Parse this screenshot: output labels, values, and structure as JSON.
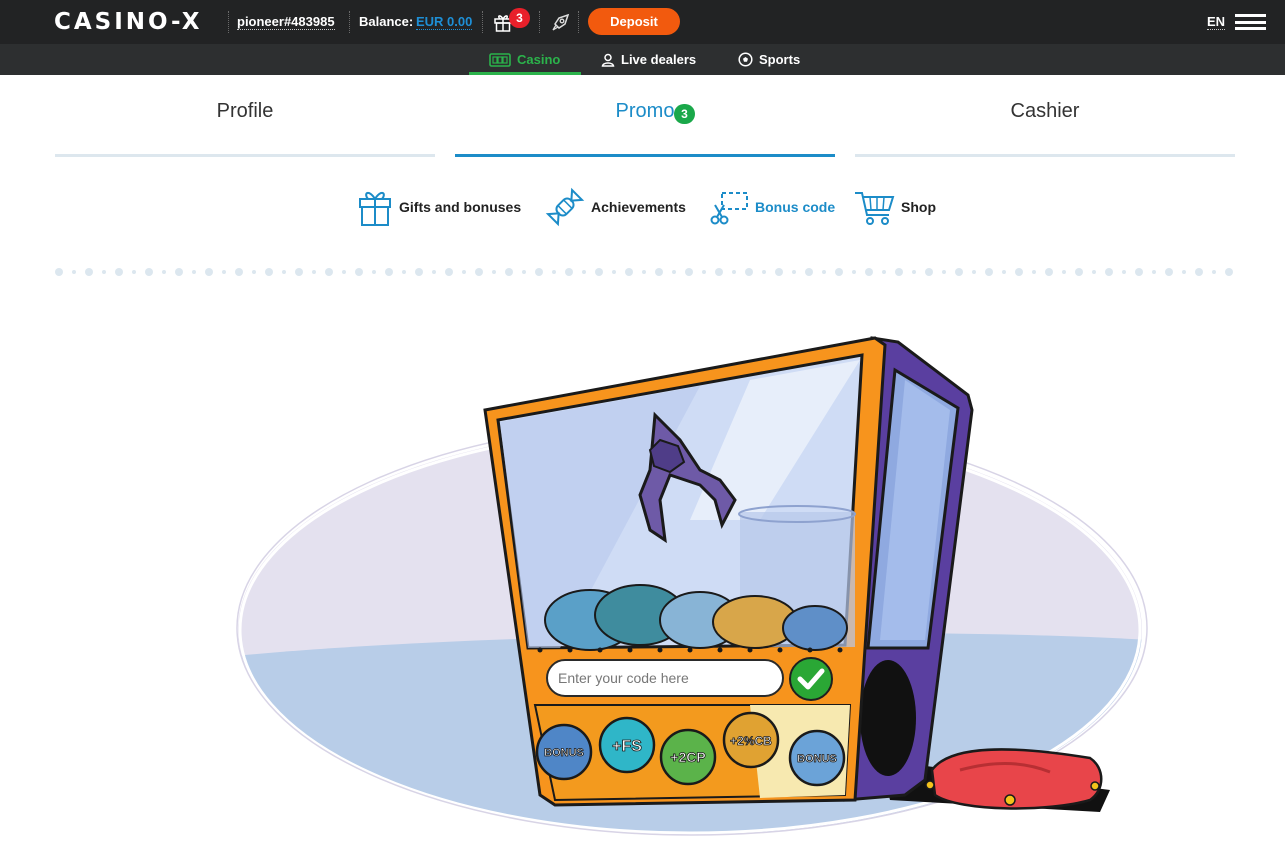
{
  "header": {
    "logo": "CASINO-X",
    "username": "pioneer#483985",
    "balance_label": "Balance:",
    "balance_value": "EUR 0.00",
    "gift_count": "3",
    "deposit_label": "Deposit",
    "language": "EN"
  },
  "subnav": {
    "items": [
      {
        "label": "Casino",
        "icon": "slot-machine-icon",
        "active": true
      },
      {
        "label": "Live dealers",
        "icon": "dealer-icon"
      },
      {
        "label": "Sports",
        "icon": "football-icon"
      }
    ]
  },
  "tabs": [
    {
      "label": "Profile"
    },
    {
      "label": "Promo",
      "badge": "3",
      "active": true
    },
    {
      "label": "Cashier"
    }
  ],
  "subtabs": [
    {
      "label": "Gifts and bonuses",
      "icon": "gift-icon"
    },
    {
      "label": "Achievements",
      "icon": "candy-icon"
    },
    {
      "label": "Bonus code",
      "icon": "scissors-coupon-icon",
      "active": true
    },
    {
      "label": "Shop",
      "icon": "cart-icon"
    }
  ],
  "bonus_code": {
    "placeholder": "Enter your code here",
    "submit_icon": "checkmark-icon",
    "chip_labels": [
      "BONUS",
      "+FS",
      "+2CP",
      "+2%CB",
      "BONUS"
    ]
  },
  "colors": {
    "accent_blue": "#1c8cc8",
    "accent_green": "#2bb34b",
    "deposit_orange": "#f25a0e",
    "badge_red": "#e8202a",
    "topbar": "#222324"
  }
}
